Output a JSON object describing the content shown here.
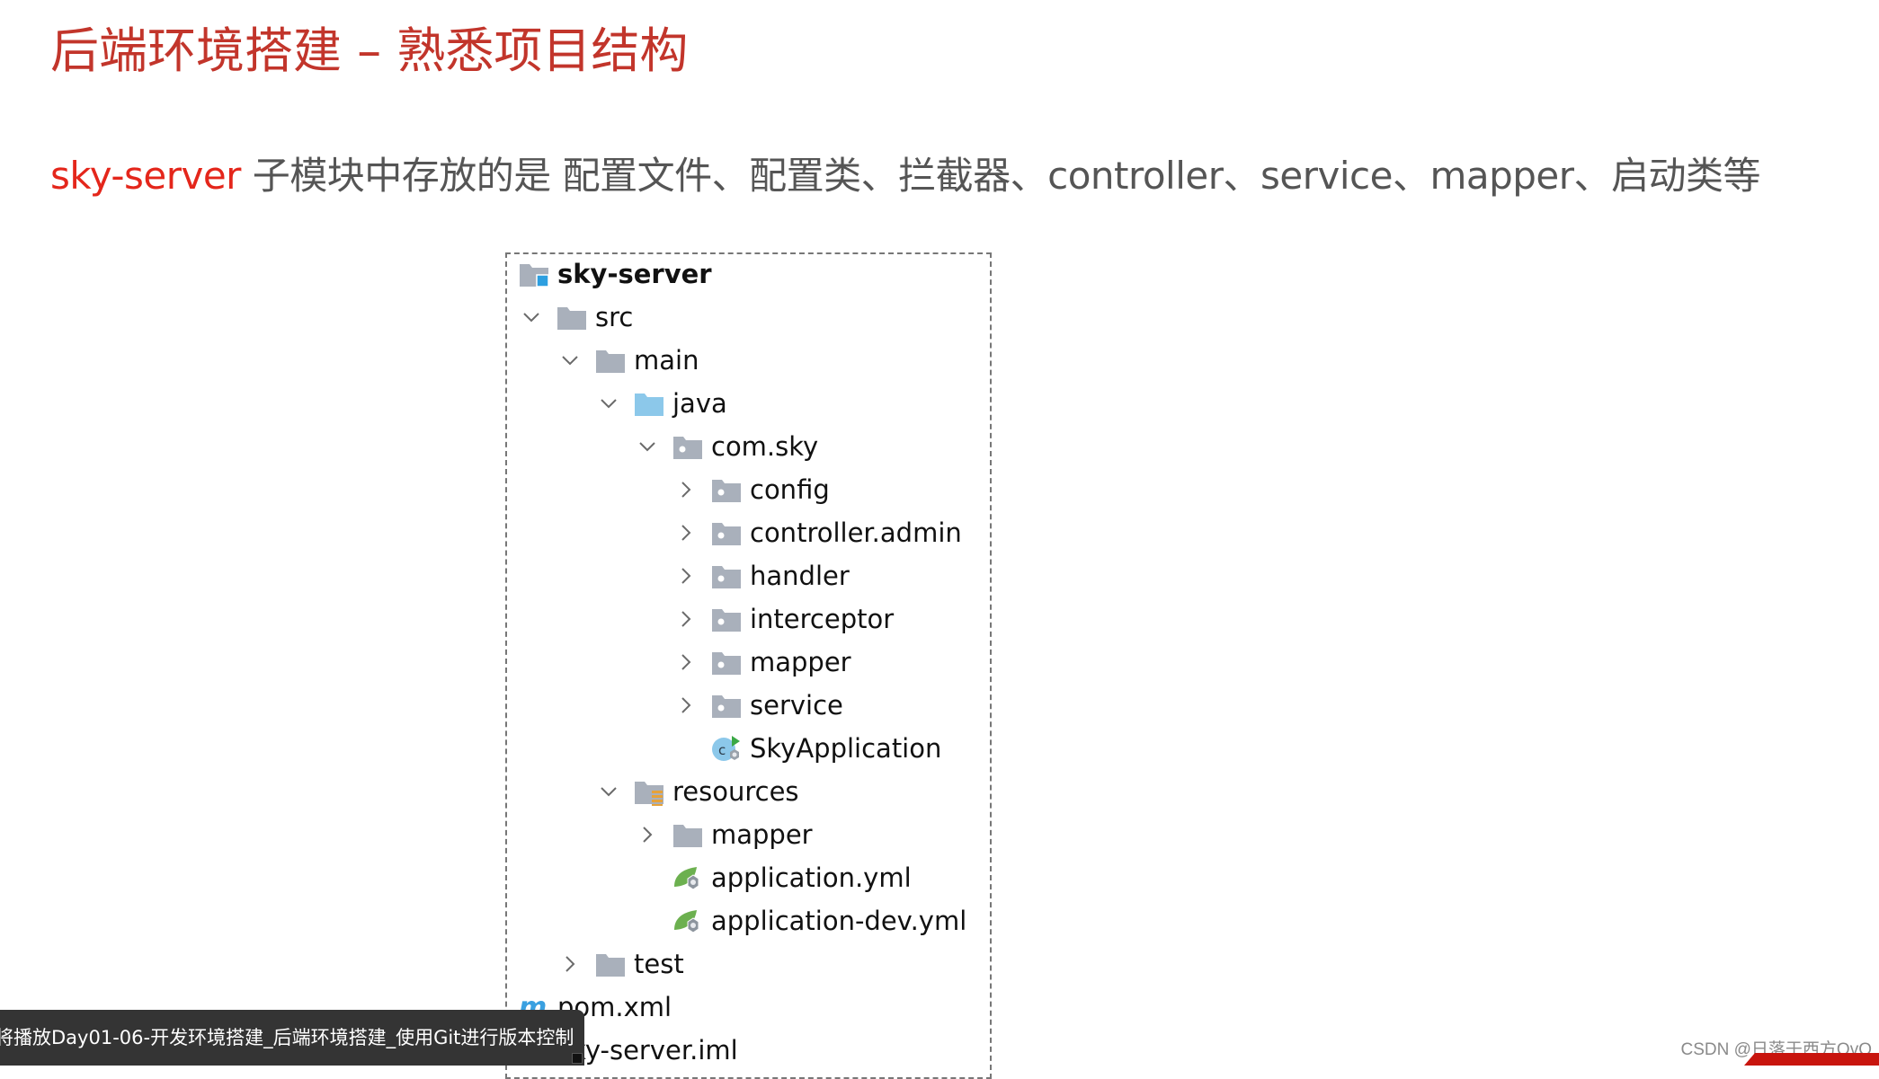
{
  "slide": {
    "title": "后端环境搭建 – 熟悉项目结构",
    "subtitle_highlight": "sky-server",
    "subtitle_rest": " 子模块中存放的是 配置文件、配置类、拦截器、controller、service、mapper、启动类等"
  },
  "colors": {
    "title": "#c2352b",
    "highlight": "#e4261b",
    "body_text": "#555555",
    "folder_gray": "#a9b0bb",
    "source_folder_blue": "#8cc8ea",
    "module_badge_blue": "#2d9fe0",
    "resources_badge_orange": "#e6a23a",
    "spring_green": "#6cb04f",
    "maven_blue": "#3aa0e0"
  },
  "tree": {
    "items": [
      {
        "label": "sky-server",
        "depth": 0,
        "expander": "none",
        "icon": "module-folder-icon",
        "bold": true
      },
      {
        "label": "src",
        "depth": 0,
        "expander": "expanded",
        "icon": "folder-icon"
      },
      {
        "label": "main",
        "depth": 1,
        "expander": "expanded",
        "icon": "folder-icon"
      },
      {
        "label": "java",
        "depth": 2,
        "expander": "expanded",
        "icon": "source-folder-icon"
      },
      {
        "label": "com.sky",
        "depth": 3,
        "expander": "expanded",
        "icon": "package-icon"
      },
      {
        "label": "config",
        "depth": 4,
        "expander": "collapsed",
        "icon": "package-icon"
      },
      {
        "label": "controller.admin",
        "depth": 4,
        "expander": "collapsed",
        "icon": "package-icon"
      },
      {
        "label": "handler",
        "depth": 4,
        "expander": "collapsed",
        "icon": "package-icon"
      },
      {
        "label": "interceptor",
        "depth": 4,
        "expander": "collapsed",
        "icon": "package-icon"
      },
      {
        "label": "mapper",
        "depth": 4,
        "expander": "collapsed",
        "icon": "package-icon"
      },
      {
        "label": "service",
        "depth": 4,
        "expander": "collapsed",
        "icon": "package-icon"
      },
      {
        "label": "SkyApplication",
        "depth": 4,
        "expander": "none",
        "icon": "spring-boot-class-icon"
      },
      {
        "label": "resources",
        "depth": 2,
        "expander": "expanded",
        "icon": "resources-folder-icon"
      },
      {
        "label": "mapper",
        "depth": 3,
        "expander": "collapsed",
        "icon": "folder-icon"
      },
      {
        "label": "application.yml",
        "depth": 3,
        "expander": "none",
        "icon": "spring-config-icon"
      },
      {
        "label": "application-dev.yml",
        "depth": 3,
        "expander": "none",
        "icon": "spring-config-icon"
      },
      {
        "label": "test",
        "depth": 1,
        "expander": "collapsed",
        "icon": "folder-icon"
      },
      {
        "label": "pom.xml",
        "depth": 0,
        "expander": "none",
        "icon": "maven-icon"
      },
      {
        "label": "sky-server.iml",
        "depth": 0,
        "expander": "none",
        "icon": "iml-file-icon"
      }
    ]
  },
  "player": {
    "next_up_text": "将播放Day01-06-开发环境搭建_后端环境搭建_使用Git进行版本控制"
  },
  "watermark": {
    "text": "CSDN @日落于西方OvO"
  }
}
